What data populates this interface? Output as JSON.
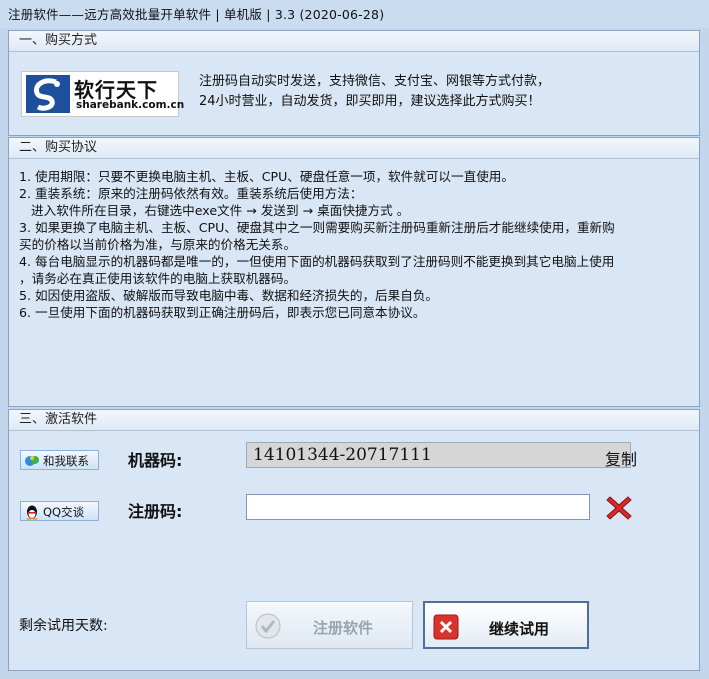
{
  "window": {
    "title": "注册软件——远方高效批量开单软件 | 单机版 | 3.3 (2020-06-28)"
  },
  "purchase": {
    "header": "一、购买方式",
    "logo_cn": "软行天下",
    "logo_en": "sharebank.com.cn",
    "text_line1": "注册码自动实时发送，支持微信、支付宝、网银等方式付款，",
    "text_line2": "24小时营业，自动发货，即买即用，建议选择此方式购买！"
  },
  "agreement": {
    "header": "二、购买协议",
    "lines": [
      "1. 使用期限：只要不更换电脑主机、主板、CPU、硬盘任意一项，软件就可以一直使用。",
      "2. 重装系统：原来的注册码依然有效。重装系统后使用方法：",
      "   进入软件所在目录，右键选中exe文件 → 发送到 → 桌面快捷方式 。",
      "3. 如果更换了电脑主机、主板、CPU、硬盘其中之一则需要购买新注册码重新注册后才能继续使用，重新购",
      "买的价格以当前价格为准，与原来的价格无关系。",
      "4. 每台电脑显示的机器码都是唯一的，一但使用下面的机器码获取到了注册码则不能更换到其它电脑上使用",
      "，请务必在真正使用该软件的电脑上获取机器码。",
      "5. 如因使用盗版、破解版而导致电脑中毒、数据和经济损失的，后果自负。",
      "6. 一旦使用下面的机器码获取到正确注册码后，即表示您已同意本协议。"
    ]
  },
  "activate": {
    "header": "三、激活软件",
    "contact_button": "和我联系",
    "qq_button": "QQ交谈",
    "machine_label": "机器码:",
    "machine_code": "14101344-20717111",
    "copy_label": "复制",
    "reg_label": "注册码:",
    "reg_value": "",
    "trial_label": "剩余试用天数:",
    "register_button": "注册软件",
    "continue_button": "继续试用"
  },
  "icons": {
    "contact": "msn-contact-icon",
    "qq": "qq-penguin-icon",
    "clear": "red-x-icon",
    "register": "check-icon",
    "continue": "close-icon"
  },
  "colors": {
    "window_bg": "#c3d6ec",
    "section_bg": "#d8e6f5",
    "clear_red": "#d42a2a"
  }
}
